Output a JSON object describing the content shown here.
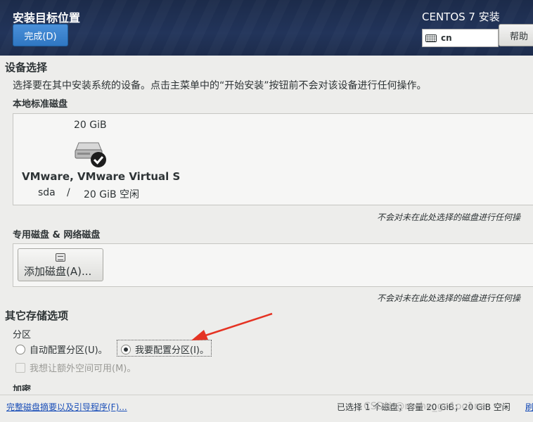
{
  "header": {
    "page_title": "安装目标位置",
    "done_label": "完成(D)",
    "product_title": "CENTOS 7 安装",
    "keyboard_layout": "cn",
    "help_label": "帮助"
  },
  "device_selection": {
    "title": "设备选择",
    "description": "选择要在其中安装系统的设备。点击主菜单中的“开始安装”按钮前不会对该设备进行任何操作。",
    "local_disks_title": "本地标准磁盘",
    "disk": {
      "size": "20 GiB",
      "name": "VMware, VMware Virtual S",
      "device": "sda",
      "separator": "/",
      "free": "20 GiB 空闲",
      "selected": true
    },
    "local_note": "不会对未在此处选择的磁盘进行任何操",
    "special_title": "专用磁盘 & 网络磁盘",
    "add_disk_label": "添加磁盘(A)...",
    "special_note": "不会对未在此处选择的磁盘进行任何操"
  },
  "other_storage": {
    "title": "其它存储选项",
    "partition_title": "分区",
    "auto_partition_label": "自动配置分区(U)。",
    "manual_partition_label": "我要配置分区(I)。",
    "selected_option": "manual",
    "extra_space_label": "我想让额外空间可用(M)。",
    "encryption_title": "加密"
  },
  "footer": {
    "summary_link": "完整磁盘摘要以及引导程序(F)...",
    "summary_text": "已选择 1 个磁盘；容量 20 GiB；20 GiB 空闲",
    "refresh_label": "刷"
  },
  "watermark": "CSDN @roche_go1oo1ne",
  "colors": {
    "header_bg": "#1f2f50",
    "done_button": "#3583cf",
    "link": "#1b4fb8",
    "annotation_arrow": "#e53323"
  }
}
